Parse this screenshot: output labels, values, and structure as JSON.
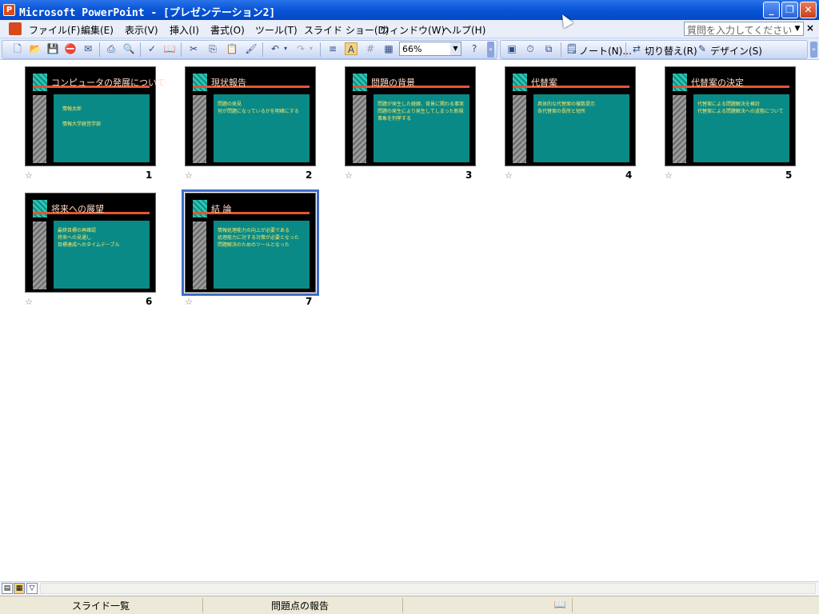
{
  "window": {
    "title": "Microsoft PowerPoint - [プレゼンテーション2]",
    "app_icon": "P"
  },
  "menu": {
    "items": [
      "ファイル(F)",
      "編集(E)",
      "表示(V)",
      "挿入(I)",
      "書式(O)",
      "ツール(T)",
      "スライド ショー(D)",
      "ウィンドウ(W)",
      "ヘルプ(H)"
    ],
    "ask_placeholder": "質問を入力してください",
    "close_glyph": "×"
  },
  "toolbar": {
    "zoom_value": "66%",
    "notes_label": "ノート(N)...",
    "transition_label": "切り替え(R)",
    "design_label": "デザイン(S)"
  },
  "slides": [
    {
      "number": "1",
      "title": "コンピュータの発展について",
      "lines": [
        "情報太郎",
        "情報大学経営学部"
      ]
    },
    {
      "number": "2",
      "title": "現状報告",
      "lines": [
        "問題の発見",
        "何が問題になっているかを明確にする"
      ]
    },
    {
      "number": "3",
      "title": "問題の背景",
      "lines": [
        "問題が発生した経緯、背景に関わる事実",
        "問題の発生により発生してしまった新規事象を列挙する"
      ]
    },
    {
      "number": "4",
      "title": "代替案",
      "lines": [
        "具体的な代替案の複数提示",
        "各代替案の長所と短所"
      ]
    },
    {
      "number": "5",
      "title": "代替案の決定",
      "lines": [
        "代替案による問題解決を検討",
        "代替案による問題解決への道筋について"
      ]
    },
    {
      "number": "6",
      "title": "将来への展望",
      "lines": [
        "最終目標の再確認",
        "将来への見通し",
        "目標達成へのタイムテーブル"
      ]
    },
    {
      "number": "7",
      "title": "結 論",
      "lines": [
        "情報処理能力の向上が必要である",
        "処理能力に対する対策が必要となった",
        "問題解決のためのツールとなった"
      ]
    }
  ],
  "slide_star": "☆",
  "statusbar": {
    "view": "スライド一覧",
    "design": "問題点の報告"
  },
  "colors": {
    "titlebar": "#0a57d9",
    "slide_bg": "#000000",
    "slide_panel": "#0a8a86",
    "slide_accent": "#e4572e",
    "selection": "#3d6bc8"
  }
}
